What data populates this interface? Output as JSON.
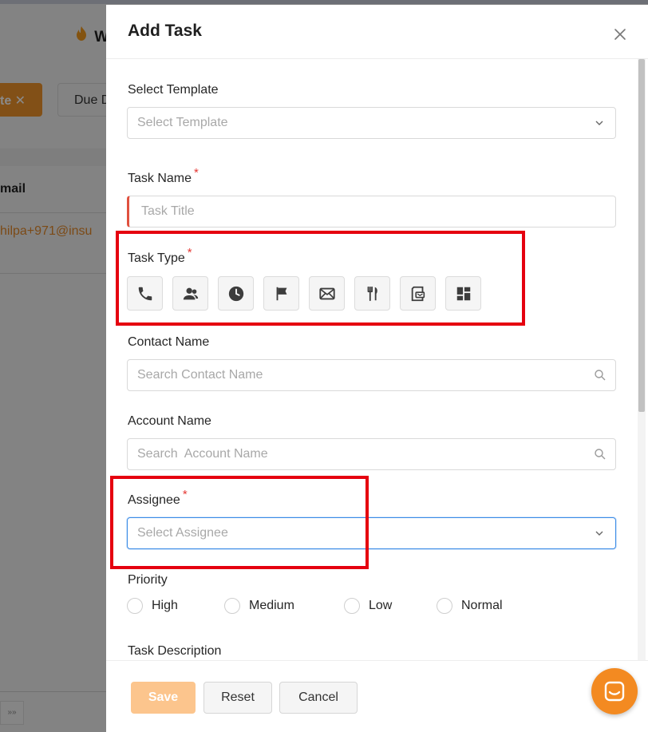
{
  "background": {
    "logo_text": "W",
    "filter_chip": "te ✕",
    "due_button": "Due D",
    "email_header": "mail",
    "email_value": "hilpa+971@insu",
    "expand_label": "»»"
  },
  "dialog": {
    "title": "Add Task",
    "close_icon": "close-icon"
  },
  "template": {
    "label": "Select Template",
    "placeholder": "Select Template"
  },
  "task_name": {
    "label": "Task Name",
    "required_mark": "*",
    "placeholder": "Task Title"
  },
  "task_type": {
    "label": "Task Type",
    "required_mark": "*",
    "icons": [
      "phone-icon",
      "meeting-icon",
      "clock-icon",
      "flag-icon",
      "email-icon",
      "meal-icon",
      "clipboard-icon",
      "dashboard-icon"
    ]
  },
  "contact": {
    "label": "Contact Name",
    "placeholder": "Search Contact Name"
  },
  "account": {
    "label": "Account Name",
    "placeholder": "Search  Account Name"
  },
  "assignee": {
    "label": "Assignee",
    "required_mark": "*",
    "placeholder": "Select Assignee"
  },
  "priority": {
    "label": "Priority",
    "options": [
      "High",
      "Medium",
      "Low",
      "Normal"
    ]
  },
  "description": {
    "label": "Task Description"
  },
  "footer": {
    "save_label": "Save",
    "reset_label": "Reset",
    "cancel_label": "Cancel"
  },
  "colors": {
    "accent": "#f38a21",
    "save_disabled": "#fcc58d",
    "required": "#e53935",
    "highlight": "#e5000f",
    "focus": "#3b8be6"
  }
}
